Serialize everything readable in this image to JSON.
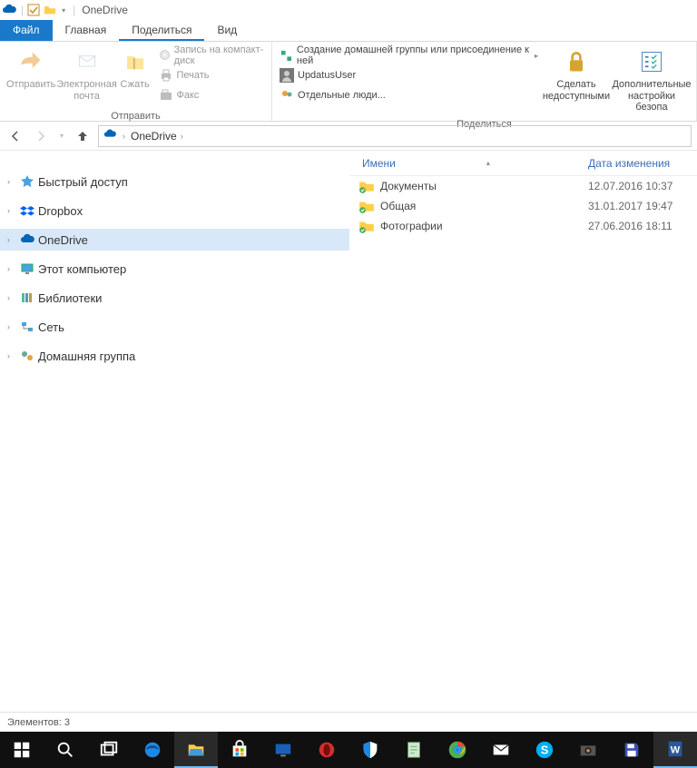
{
  "titlebar": {
    "title": "OneDrive"
  },
  "tabs": {
    "file": "Файл",
    "home": "Главная",
    "share": "Поделиться",
    "view": "Вид"
  },
  "ribbon": {
    "send_group_label": "Отправить",
    "send_btn": "Отправить",
    "email_btn": "Электронная\nпочта",
    "compress_btn": "Сжать",
    "burn_cd": "Запись на компакт-диск",
    "print": "Печать",
    "fax": "Факс",
    "share_group_label": "Поделиться",
    "homegroup_create": "Создание домашней группы или присоединение к ней",
    "updatus_user": "UpdatusUser",
    "specific_people": "Отдельные люди...",
    "stop_sharing": "Сделать\nнедоступными",
    "adv_security": "Дополнительные\nнастройки безопа"
  },
  "breadcrumb": {
    "location": "OneDrive"
  },
  "tree": {
    "quick_access": "Быстрый доступ",
    "dropbox": "Dropbox",
    "onedrive": "OneDrive",
    "this_pc": "Этот компьютер",
    "libraries": "Библиотеки",
    "network": "Сеть",
    "homegroup": "Домашняя группа"
  },
  "list": {
    "col_name": "Имени",
    "col_date": "Дата изменения",
    "rows": [
      {
        "name": "Документы",
        "date": "12.07.2016 10:37"
      },
      {
        "name": "Общая",
        "date": "31.01.2017 19:47"
      },
      {
        "name": "Фотографии",
        "date": "27.06.2016 18:11"
      }
    ]
  },
  "status": {
    "items_label": "Элементов:",
    "items_count": "3"
  }
}
